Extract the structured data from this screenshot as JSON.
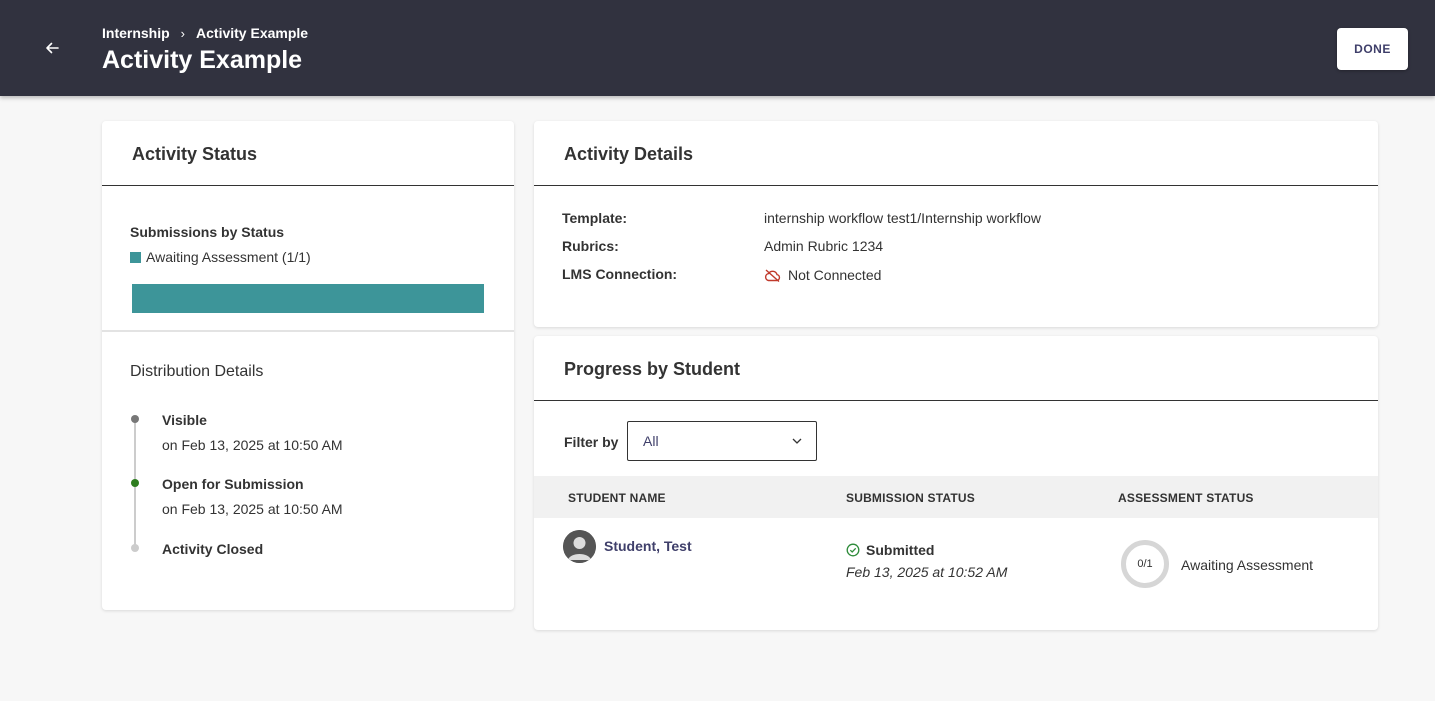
{
  "header": {
    "breadcrumb": [
      "Internship",
      "Activity Example"
    ],
    "title": "Activity Example",
    "done_label": "DONE",
    "back_icon": "arrow-left-icon"
  },
  "activity_status": {
    "title": "Activity Status",
    "submissions_heading": "Submissions by Status",
    "legend_label": "Awaiting Assessment (1/1)",
    "legend_color": "#3d9599",
    "bar_fraction": 1.0,
    "distribution_title": "Distribution Details",
    "timeline": [
      {
        "label": "Visible",
        "date": "on Feb 13, 2025 at 10:50 AM",
        "dot_color": "#777777"
      },
      {
        "label": "Open for Submission",
        "date": "on Feb 13, 2025 at 10:50 AM",
        "dot_color": "#2e7d1f"
      },
      {
        "label": "Activity Closed",
        "date": "",
        "dot_color": "#cccccc"
      }
    ]
  },
  "activity_details": {
    "title": "Activity Details",
    "rows": [
      {
        "label": "Template:",
        "value": "internship workflow test1/Internship workflow"
      },
      {
        "label": "Rubrics:",
        "value": "Admin Rubric 1234"
      },
      {
        "label": "LMS Connection:",
        "value": "Not Connected",
        "icon": "cloud-off-icon",
        "icon_color": "#c0392b"
      }
    ]
  },
  "progress": {
    "title": "Progress by Student",
    "filter_label": "Filter by",
    "filter_value": "All",
    "columns": [
      "STUDENT NAME",
      "SUBMISSION STATUS",
      "ASSESSMENT STATUS"
    ],
    "rows": [
      {
        "student": "Student, Test",
        "submission_status": "Submitted",
        "submission_date": "Feb 13, 2025 at 10:52 AM",
        "assessment_count": "0/1",
        "assessment_status": "Awaiting Assessment"
      }
    ]
  }
}
